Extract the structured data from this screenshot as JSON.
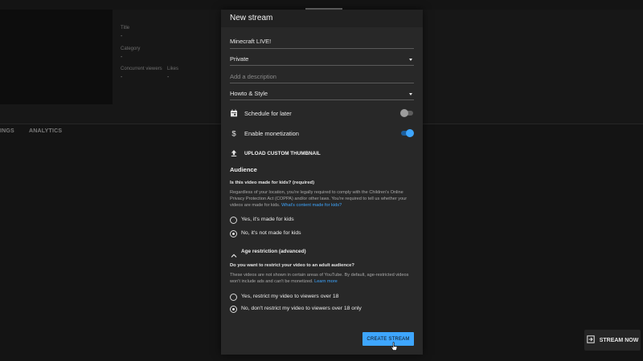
{
  "background": {
    "top_tabs": [
      "",
      "",
      ""
    ],
    "fields": [
      {
        "label": "Title",
        "value": "-"
      },
      {
        "label": "Category",
        "value": "-"
      },
      {
        "label": "Concurrent viewers",
        "value": "-"
      },
      {
        "label": "Likes",
        "value": "-"
      }
    ],
    "tabs": [
      "INGS",
      "ANALYTICS"
    ],
    "stream_now_label": "STREAM NOW"
  },
  "dialog": {
    "title": "New stream",
    "title_field": "Minecraft LIVE!",
    "visibility": "Private",
    "description_placeholder": "Add a description",
    "category": "Howto & Style",
    "schedule_label": "Schedule for later",
    "schedule_enabled": false,
    "monetization_label": "Enable monetization",
    "monetization_enabled": true,
    "upload_thumbnail_label": "UPLOAD CUSTOM THUMBNAIL",
    "audience": {
      "title": "Audience",
      "question": "Is this video made for kids? (required)",
      "description": "Regardless of your location, you're legally required to comply with the Children's Online Privacy Protection Act (COPPA) and/or other laws. You're required to tell us whether your videos are made for kids.",
      "link": "What's content made for kids?",
      "options": [
        {
          "label": "Yes, it's made for kids",
          "checked": false
        },
        {
          "label": "No, it's not made for kids",
          "checked": true
        }
      ]
    },
    "age_restriction": {
      "toggle_label": "Age restriction (advanced)",
      "question": "Do you want to restrict your video to an adult audience?",
      "description": "These videos are not shown in certain areas of YouTube. By default, age-restricted videos won't include ads and can't be monetized.",
      "link": "Learn more",
      "options": [
        {
          "label": "Yes, restrict my video to viewers over 18",
          "checked": false
        },
        {
          "label": "No, don't restrict my video to viewers over 18 only",
          "checked": true
        }
      ]
    },
    "create_button": "CREATE STREAM"
  },
  "colors": {
    "accent": "#3ea6ff",
    "dialog_bg": "#282828",
    "page_bg": "#1a1a1a"
  },
  "icons": {
    "schedule": "calendar-icon",
    "monetization": "dollar-icon",
    "upload": "upload-icon",
    "expand": "chevron-up-icon",
    "stream_now": "exit-arrow-icon"
  }
}
